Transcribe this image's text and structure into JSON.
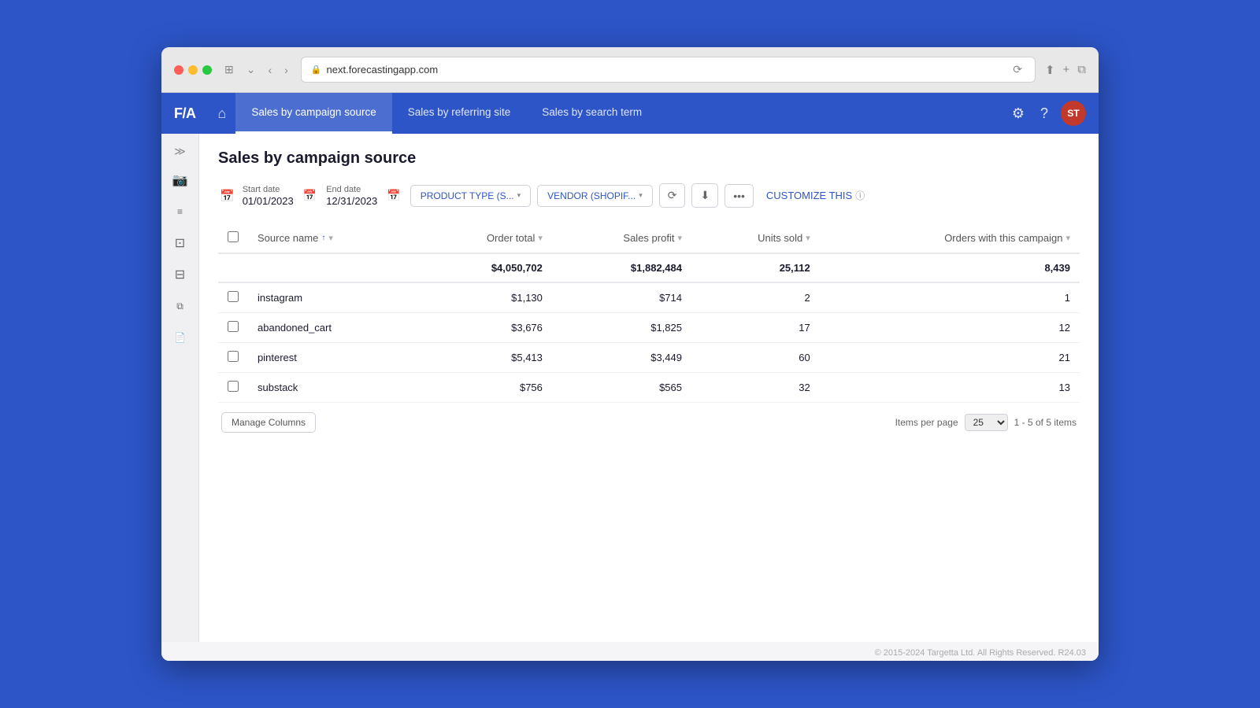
{
  "browser": {
    "url": "next.forecastingapp.com",
    "refresh_icon": "⟳"
  },
  "app": {
    "logo": "F/A",
    "nav_tabs": [
      {
        "id": "campaign",
        "label": "Sales by campaign source",
        "active": true
      },
      {
        "id": "referring",
        "label": "Sales by referring site",
        "active": false
      },
      {
        "id": "search",
        "label": "Sales by search term",
        "active": false
      }
    ],
    "avatar_initials": "ST"
  },
  "page": {
    "title": "Sales by campaign source",
    "start_date_label": "Start date",
    "start_date_value": "01/01/2023",
    "end_date_label": "End date",
    "end_date_value": "12/31/2023",
    "filter_product": "PRODUCT TYPE (S...",
    "filter_vendor": "VENDOR (SHOPIF...",
    "customize_label": "CUSTOMIZE THIS"
  },
  "table": {
    "columns": [
      {
        "id": "source_name",
        "label": "Source name",
        "active": true,
        "numeric": false
      },
      {
        "id": "order_total",
        "label": "Order total",
        "active": false,
        "numeric": true
      },
      {
        "id": "sales_profit",
        "label": "Sales profit",
        "active": false,
        "numeric": true
      },
      {
        "id": "units_sold",
        "label": "Units sold",
        "active": false,
        "numeric": true
      },
      {
        "id": "orders",
        "label": "Orders with this campaign",
        "active": false,
        "numeric": true
      }
    ],
    "total_row": {
      "source_name": "",
      "order_total": "$4,050,702",
      "sales_profit": "$1,882,484",
      "units_sold": "25,112",
      "orders": "8,439"
    },
    "rows": [
      {
        "source_name": "instagram",
        "order_total": "$1,130",
        "sales_profit": "$714",
        "units_sold": "2",
        "orders": "1"
      },
      {
        "source_name": "abandoned_cart",
        "order_total": "$3,676",
        "sales_profit": "$1,825",
        "units_sold": "17",
        "orders": "12"
      },
      {
        "source_name": "pinterest",
        "order_total": "$5,413",
        "sales_profit": "$3,449",
        "units_sold": "60",
        "orders": "21"
      },
      {
        "source_name": "substack",
        "order_total": "$756",
        "sales_profit": "$565",
        "units_sold": "32",
        "orders": "13"
      }
    ],
    "footer": {
      "manage_columns": "Manage Columns",
      "items_per_page_label": "Items per page",
      "items_per_page_value": "25",
      "pagination_text": "1 - 5 of 5 items"
    }
  },
  "copyright": "© 2015-2024 Targetta Ltd. All Rights Reserved. R24.03"
}
